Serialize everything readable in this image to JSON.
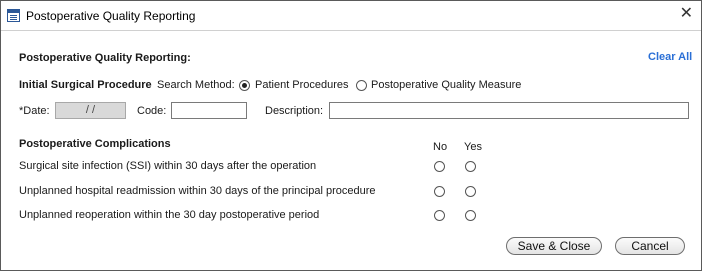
{
  "window": {
    "title": "Postoperative Quality Reporting",
    "close_glyph": "✕"
  },
  "header": {
    "heading": "Postoperative Quality Reporting:",
    "clear_all": "Clear All"
  },
  "procedure": {
    "label": "Initial Surgical Procedure",
    "search_method_label": "Search Method:",
    "options": [
      {
        "label": "Patient Procedures",
        "selected": true
      },
      {
        "label": "Postoperative Quality Measure",
        "selected": false
      }
    ]
  },
  "fields": {
    "date_label": "*Date:",
    "date_value": "/ /",
    "code_label": "Code:",
    "code_value": "",
    "description_label": "Description:",
    "description_value": ""
  },
  "complications": {
    "heading": "Postoperative Complications",
    "col_no": "No",
    "col_yes": "Yes",
    "items": [
      {
        "label": "Surgical site infection (SSI) within 30 days after the operation"
      },
      {
        "label": "Unplanned hospital readmission within 30 days of the principal procedure"
      },
      {
        "label": "Unplanned reoperation within the 30 day postoperative period"
      }
    ]
  },
  "buttons": {
    "save_close": "Save & Close",
    "cancel": "Cancel"
  },
  "icons": {
    "window_icon": "table-icon"
  }
}
